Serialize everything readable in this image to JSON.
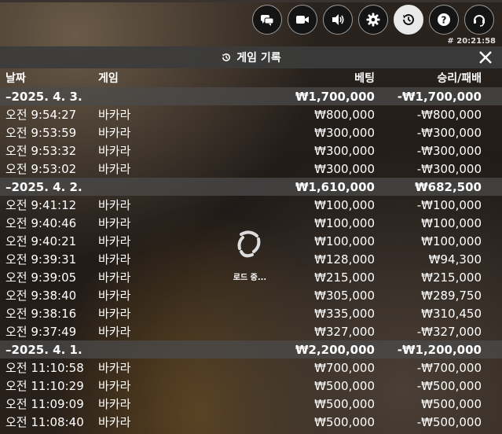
{
  "header": {
    "time": "# 20:21:58"
  },
  "panel": {
    "title": "게임 기록"
  },
  "columns": {
    "date": "날짜",
    "game": "게임",
    "bet": "베팅",
    "result": "승리/패배"
  },
  "groups": [
    {
      "date": "–2025. 4. 3.",
      "bet": "₩1,700,000",
      "result": "-₩1,700,000",
      "rows": [
        {
          "time": "오전 9:54:27",
          "game": "바카라",
          "bet": "₩800,000",
          "result": "-₩800,000"
        },
        {
          "time": "오전 9:53:59",
          "game": "바카라",
          "bet": "₩300,000",
          "result": "-₩300,000"
        },
        {
          "time": "오전 9:53:32",
          "game": "바카라",
          "bet": "₩300,000",
          "result": "-₩300,000"
        },
        {
          "time": "오전 9:53:02",
          "game": "바카라",
          "bet": "₩300,000",
          "result": "-₩300,000"
        }
      ]
    },
    {
      "date": "–2025. 4. 2.",
      "bet": "₩1,610,000",
      "result": "₩682,500",
      "rows": [
        {
          "time": "오전 9:41:12",
          "game": "바카라",
          "bet": "₩100,000",
          "result": "-₩100,000"
        },
        {
          "time": "오전 9:40:46",
          "game": "바카라",
          "bet": "₩100,000",
          "result": "₩100,000"
        },
        {
          "time": "오전 9:40:21",
          "game": "바카라",
          "bet": "₩100,000",
          "result": "₩100,000"
        },
        {
          "time": "오전 9:39:31",
          "game": "바카라",
          "bet": "₩128,000",
          "result": "₩94,300"
        },
        {
          "time": "오전 9:39:05",
          "game": "바카라",
          "bet": "₩215,000",
          "result": "₩215,000"
        },
        {
          "time": "오전 9:38:40",
          "game": "바카라",
          "bet": "₩305,000",
          "result": "₩289,750"
        },
        {
          "time": "오전 9:38:16",
          "game": "바카라",
          "bet": "₩335,000",
          "result": "₩310,450"
        },
        {
          "time": "오전 9:37:49",
          "game": "바카라",
          "bet": "₩327,000",
          "result": "-₩327,000"
        }
      ]
    },
    {
      "date": "–2025. 4. 1.",
      "bet": "₩2,200,000",
      "result": "-₩1,200,000",
      "rows": [
        {
          "time": "오전 11:10:58",
          "game": "바카라",
          "bet": "₩700,000",
          "result": "-₩700,000"
        },
        {
          "time": "오전 11:10:29",
          "game": "바카라",
          "bet": "₩500,000",
          "result": "-₩500,000"
        },
        {
          "time": "오전 11:09:09",
          "game": "바카라",
          "bet": "₩500,000",
          "result": "₩500,000"
        },
        {
          "time": "오전 11:08:40",
          "game": "바카라",
          "bet": "₩500,000",
          "result": "-₩500,000"
        }
      ]
    }
  ],
  "loading": {
    "text": "로드 중..."
  }
}
